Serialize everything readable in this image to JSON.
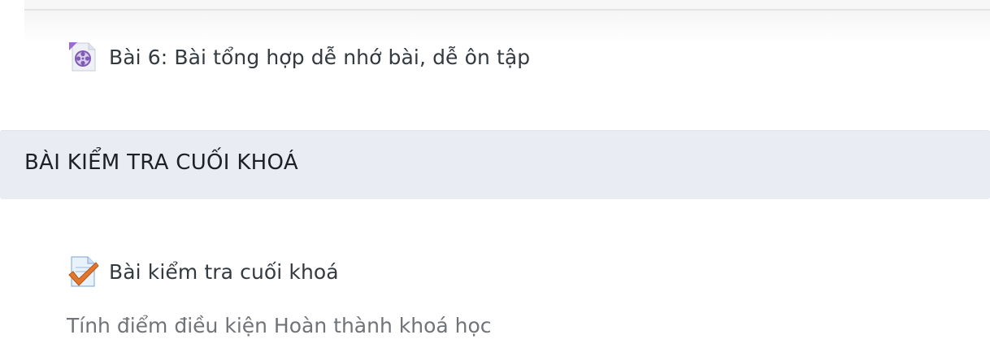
{
  "activities": [
    {
      "title": "Bài 6: Bài tổng hợp dễ nhớ bài, dễ ôn tập",
      "icon": "video-file-icon"
    },
    {
      "title": "Bài kiểm tra cuối khoá",
      "icon": "quiz-checkmark-icon",
      "description": "Tính điểm điều kiện Hoàn thành khoá học"
    }
  ],
  "section": {
    "title": "BÀI KIỂM TRA CUỐI KHOÁ"
  },
  "colors": {
    "section_bg": "#e9edf3",
    "link_text": "#333a40",
    "muted_text": "#707478"
  }
}
